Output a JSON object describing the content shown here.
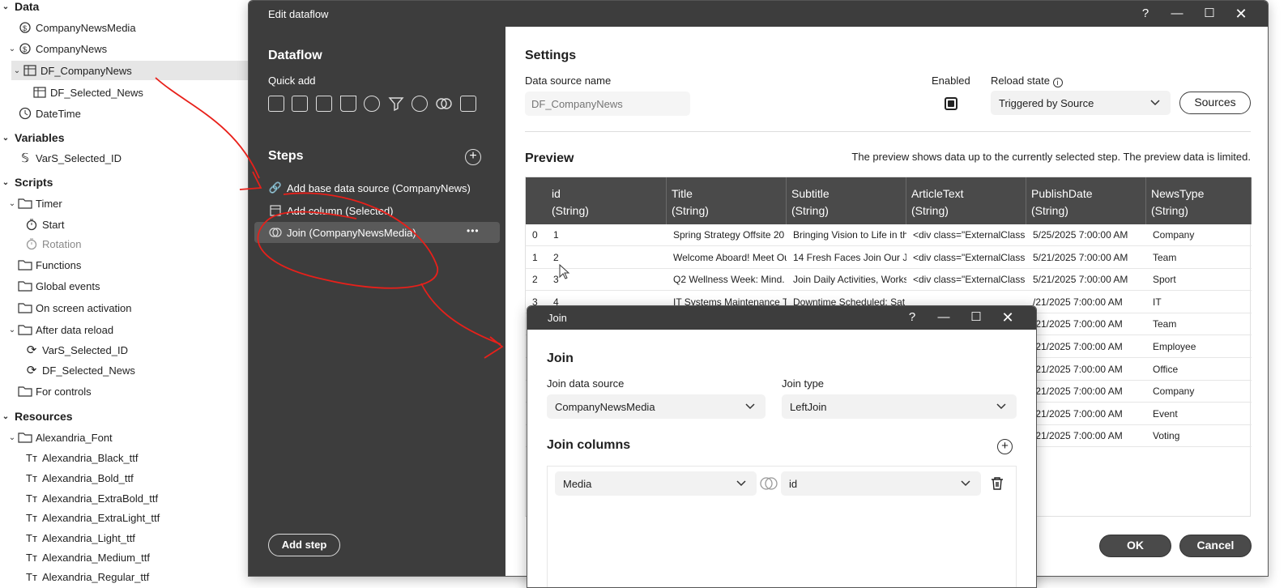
{
  "tree": {
    "sections": {
      "data": "Data",
      "variables": "Variables",
      "scripts": "Scripts",
      "resources": "Resources"
    },
    "items": {
      "company_news_media": "CompanyNewsMedia",
      "company_news": "CompanyNews",
      "df_company_news": "DF_CompanyNews",
      "df_selected_news": "DF_Selected_News",
      "date_time": "DateTime",
      "vars_selected_id": "VarS_Selected_ID",
      "timer": "Timer",
      "start": "Start",
      "rotation": "Rotation",
      "functions": "Functions",
      "global_events": "Global events",
      "on_screen_activation": "On screen activation",
      "after_data_reload": "After data reload",
      "reload_vars_selected_id": "VarS_Selected_ID",
      "reload_df_selected_news": "DF_Selected_News",
      "for_controls": "For controls",
      "alexandria_font": "Alexandria_Font",
      "fonts": [
        "Alexandria_Black_ttf",
        "Alexandria_Bold_ttf",
        "Alexandria_ExtraBold_ttf",
        "Alexandria_ExtraLight_ttf",
        "Alexandria_Light_ttf",
        "Alexandria_Medium_ttf",
        "Alexandria_Regular_ttf"
      ]
    }
  },
  "dataflow_window": {
    "title": "Edit dataflow",
    "left": {
      "heading": "Dataflow",
      "quick_add": "Quick add",
      "quick_add_icons": [
        "add-table-icon",
        "text-column-icon",
        "add-column-icon",
        "delete-icon",
        "refresh-icon",
        "filter-icon",
        "sort-icon",
        "join-icon",
        "calculator-icon"
      ],
      "steps_heading": "Steps",
      "steps": [
        {
          "label": "Add base data source (CompanyNews)",
          "icon": "link-icon"
        },
        {
          "label": "Add column (Selected)",
          "icon": "add-column-icon"
        },
        {
          "label": "Join (CompanyNewsMedia)",
          "icon": "join-icon"
        }
      ],
      "more": "•••",
      "add_step": "Add step"
    },
    "settings": {
      "heading": "Settings",
      "data_source_name_label": "Data source name",
      "data_source_name_placeholder": "DF_CompanyNews",
      "enabled_label": "Enabled",
      "enabled": true,
      "reload_state_label": "Reload state",
      "reload_state_value": "Triggered by Source",
      "sources_button": "Sources"
    },
    "preview": {
      "heading": "Preview",
      "note": "The preview shows data up to the currently selected step. The preview data is limited.",
      "columns": [
        {
          "name": "id",
          "type": "(String)"
        },
        {
          "name": "Title",
          "type": "(String)"
        },
        {
          "name": "Subtitle",
          "type": "(String)"
        },
        {
          "name": "ArticleText",
          "type": "(String)"
        },
        {
          "name": "PublishDate",
          "type": "(String)"
        },
        {
          "name": "NewsType",
          "type": "(String)"
        }
      ],
      "rows": [
        [
          "0",
          "1",
          "Spring Strategy Offsite 20",
          "Bringing Vision to Life in th",
          "<div class=\"ExternalClass",
          "5/25/2025 7:00:00 AM",
          "Company"
        ],
        [
          "1",
          "2",
          "Welcome Aboard! Meet Ou",
          "14 Fresh Faces Join Our Jo",
          "<div class=\"ExternalClass",
          "5/21/2025 7:00:00 AM",
          "Team"
        ],
        [
          "2",
          "3",
          "Q2 Wellness Week: Mind. B",
          "Join Daily Activities, Works",
          "<div class=\"ExternalClass",
          "5/21/2025 7:00:00 AM",
          "Sport"
        ],
        [
          "3",
          "4",
          "IT Systems Maintenance T",
          "Downtime Scheduled: Sat",
          "",
          "/21/2025 7:00:00 AM",
          "IT"
        ],
        [
          "",
          "",
          "",
          "",
          "",
          "/21/2025 7:00:00 AM",
          "Team"
        ],
        [
          "",
          "",
          "",
          "",
          "",
          "/21/2025 7:00:00 AM",
          "Employee"
        ],
        [
          "",
          "",
          "",
          "",
          "",
          "/21/2025 7:00:00 AM",
          "Office"
        ],
        [
          "",
          "",
          "",
          "",
          "",
          "/21/2025 7:00:00 AM",
          "Company"
        ],
        [
          "",
          "",
          "",
          "",
          "",
          "/21/2025 7:00:00 AM",
          "Event"
        ],
        [
          "",
          "",
          "",
          "",
          "",
          "/21/2025 7:00:00 AM",
          "Voting"
        ]
      ]
    },
    "ok_button": "OK",
    "cancel_button": "Cancel"
  },
  "join_dialog": {
    "title": "Join",
    "heading": "Join",
    "join_data_source_label": "Join data source",
    "join_data_source_value": "CompanyNewsMedia",
    "join_type_label": "Join type",
    "join_type_value": "LeftJoin",
    "join_columns_heading": "Join columns",
    "left_column": "Media",
    "right_column": "id"
  },
  "colors": {
    "dark_panel": "#3d3d3d",
    "selected_step": "#5a5a5a",
    "table_header": "#4a4a4a",
    "annotation_red": "#e8201a"
  }
}
